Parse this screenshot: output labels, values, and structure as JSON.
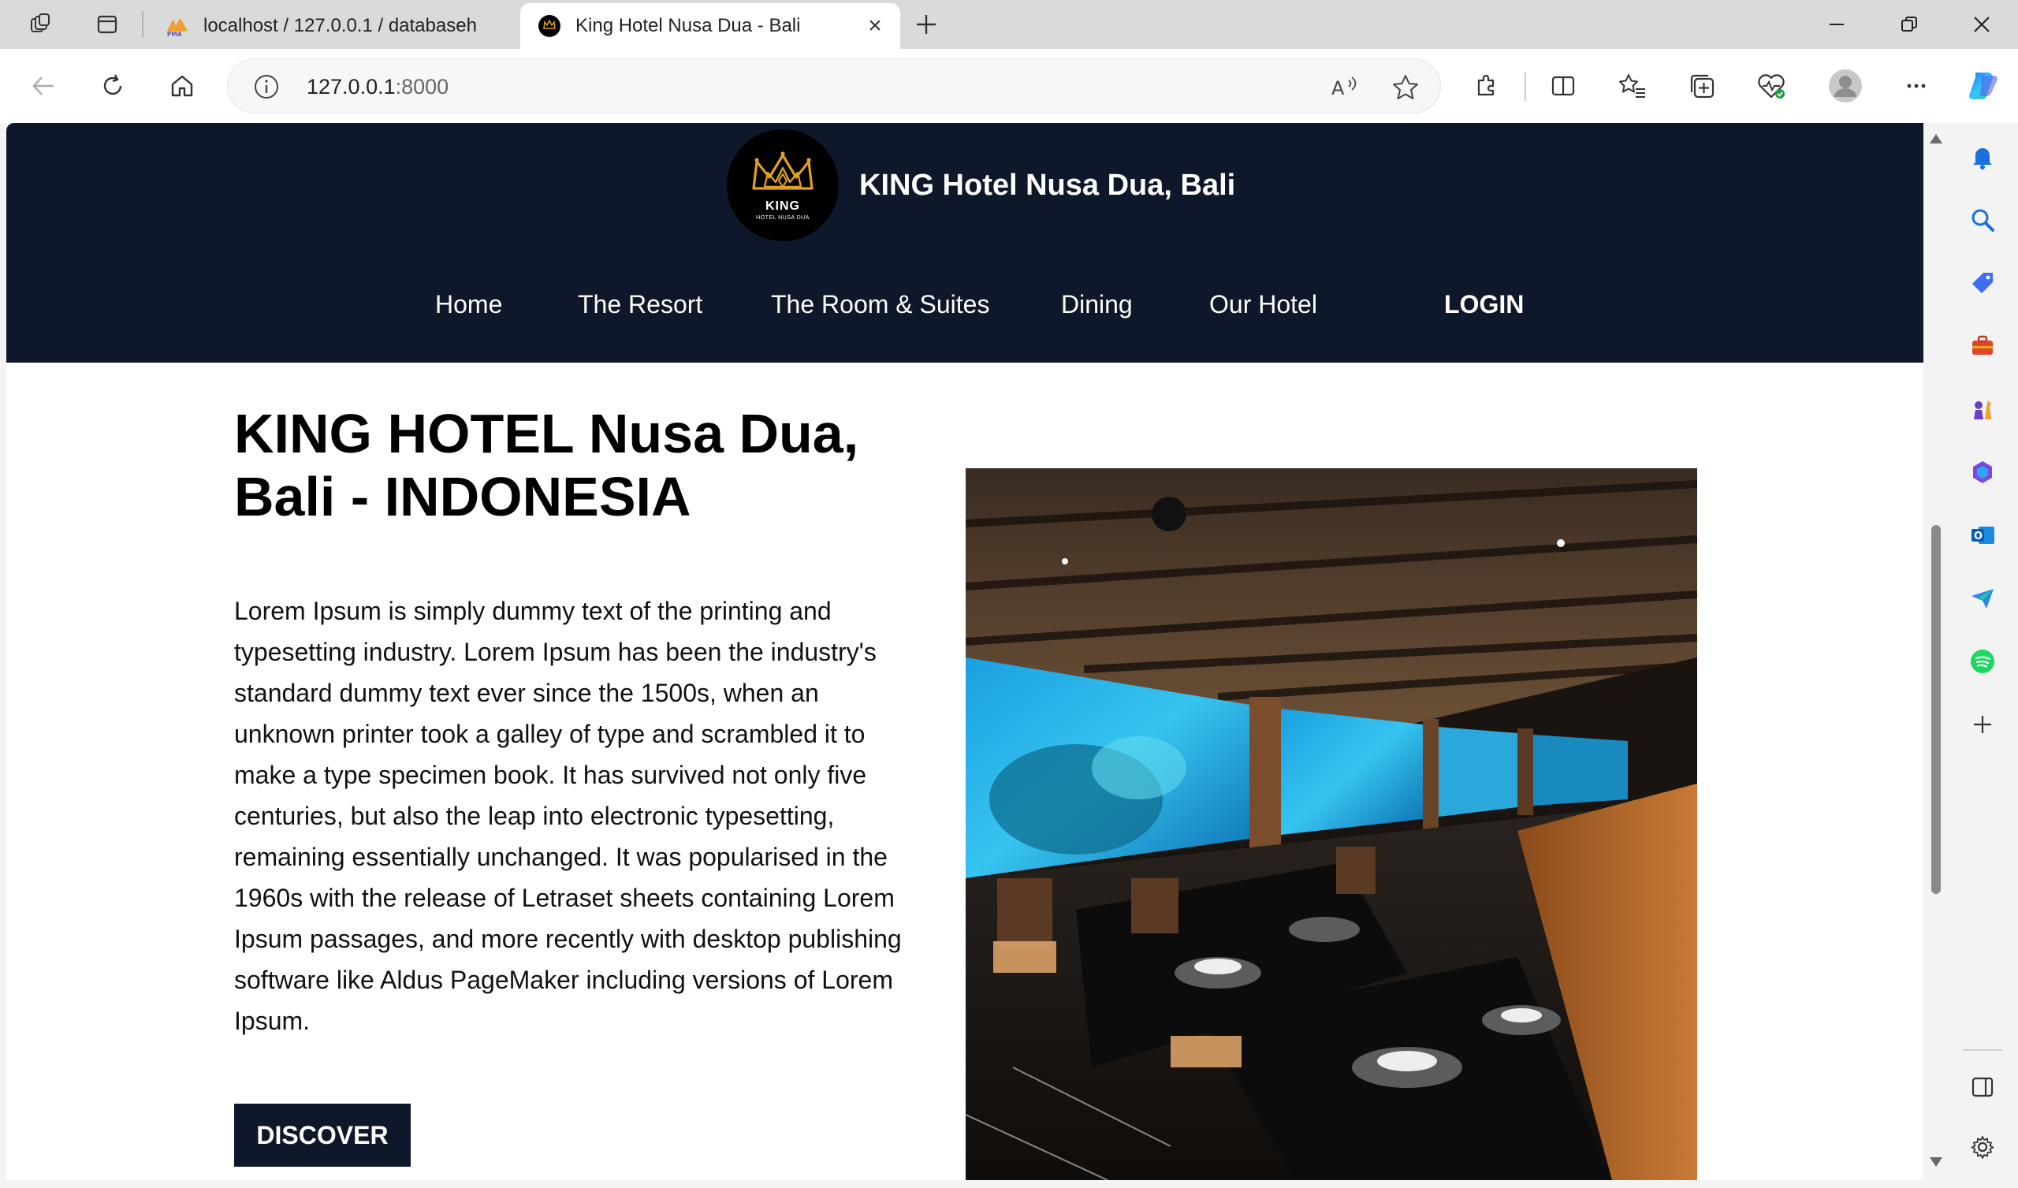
{
  "browser": {
    "tabs": [
      {
        "label": "localhost / 127.0.0.1 / databaseh",
        "favicon": "phpmyadmin-icon",
        "favicon_text": "PMA"
      },
      {
        "label": "King Hotel Nusa Dua - Bali",
        "favicon": "crown-icon",
        "active": true
      }
    ],
    "url_host": "127.0.0.1",
    "url_port": ":8000",
    "accent": "#0f172a"
  },
  "site": {
    "logo_word": "KING",
    "logo_sub": "HOTEL NUSA DUA",
    "brand_name": "KING Hotel Nusa Dua, Bali",
    "nav": {
      "home": "Home",
      "resort": "The Resort",
      "rooms": "The Room & Suites",
      "dining": "Dining",
      "our_hotel": "Our Hotel",
      "login": "LOGIN"
    }
  },
  "hero": {
    "title_line1": "KING HOTEL Nusa Dua,",
    "title_line2": "Bali - INDONESIA",
    "body": "Lorem Ipsum is simply dummy text of the printing and typesetting industry. Lorem Ipsum has been the industry's standard dummy text ever since the 1500s, when an unknown printer took a galley of type and scrambled it to make a type specimen book. It has survived not only five centuries, but also the leap into electronic typesetting, remaining essentially unchanged. It was popularised in the 1960s with the release of Letraset sheets containing Lorem Ipsum passages, and more recently with desktop publishing software like Aldus PageMaker including versions of Lorem Ipsum.",
    "button": "DISCOVER",
    "photo": "underwater-restaurant-photo"
  }
}
